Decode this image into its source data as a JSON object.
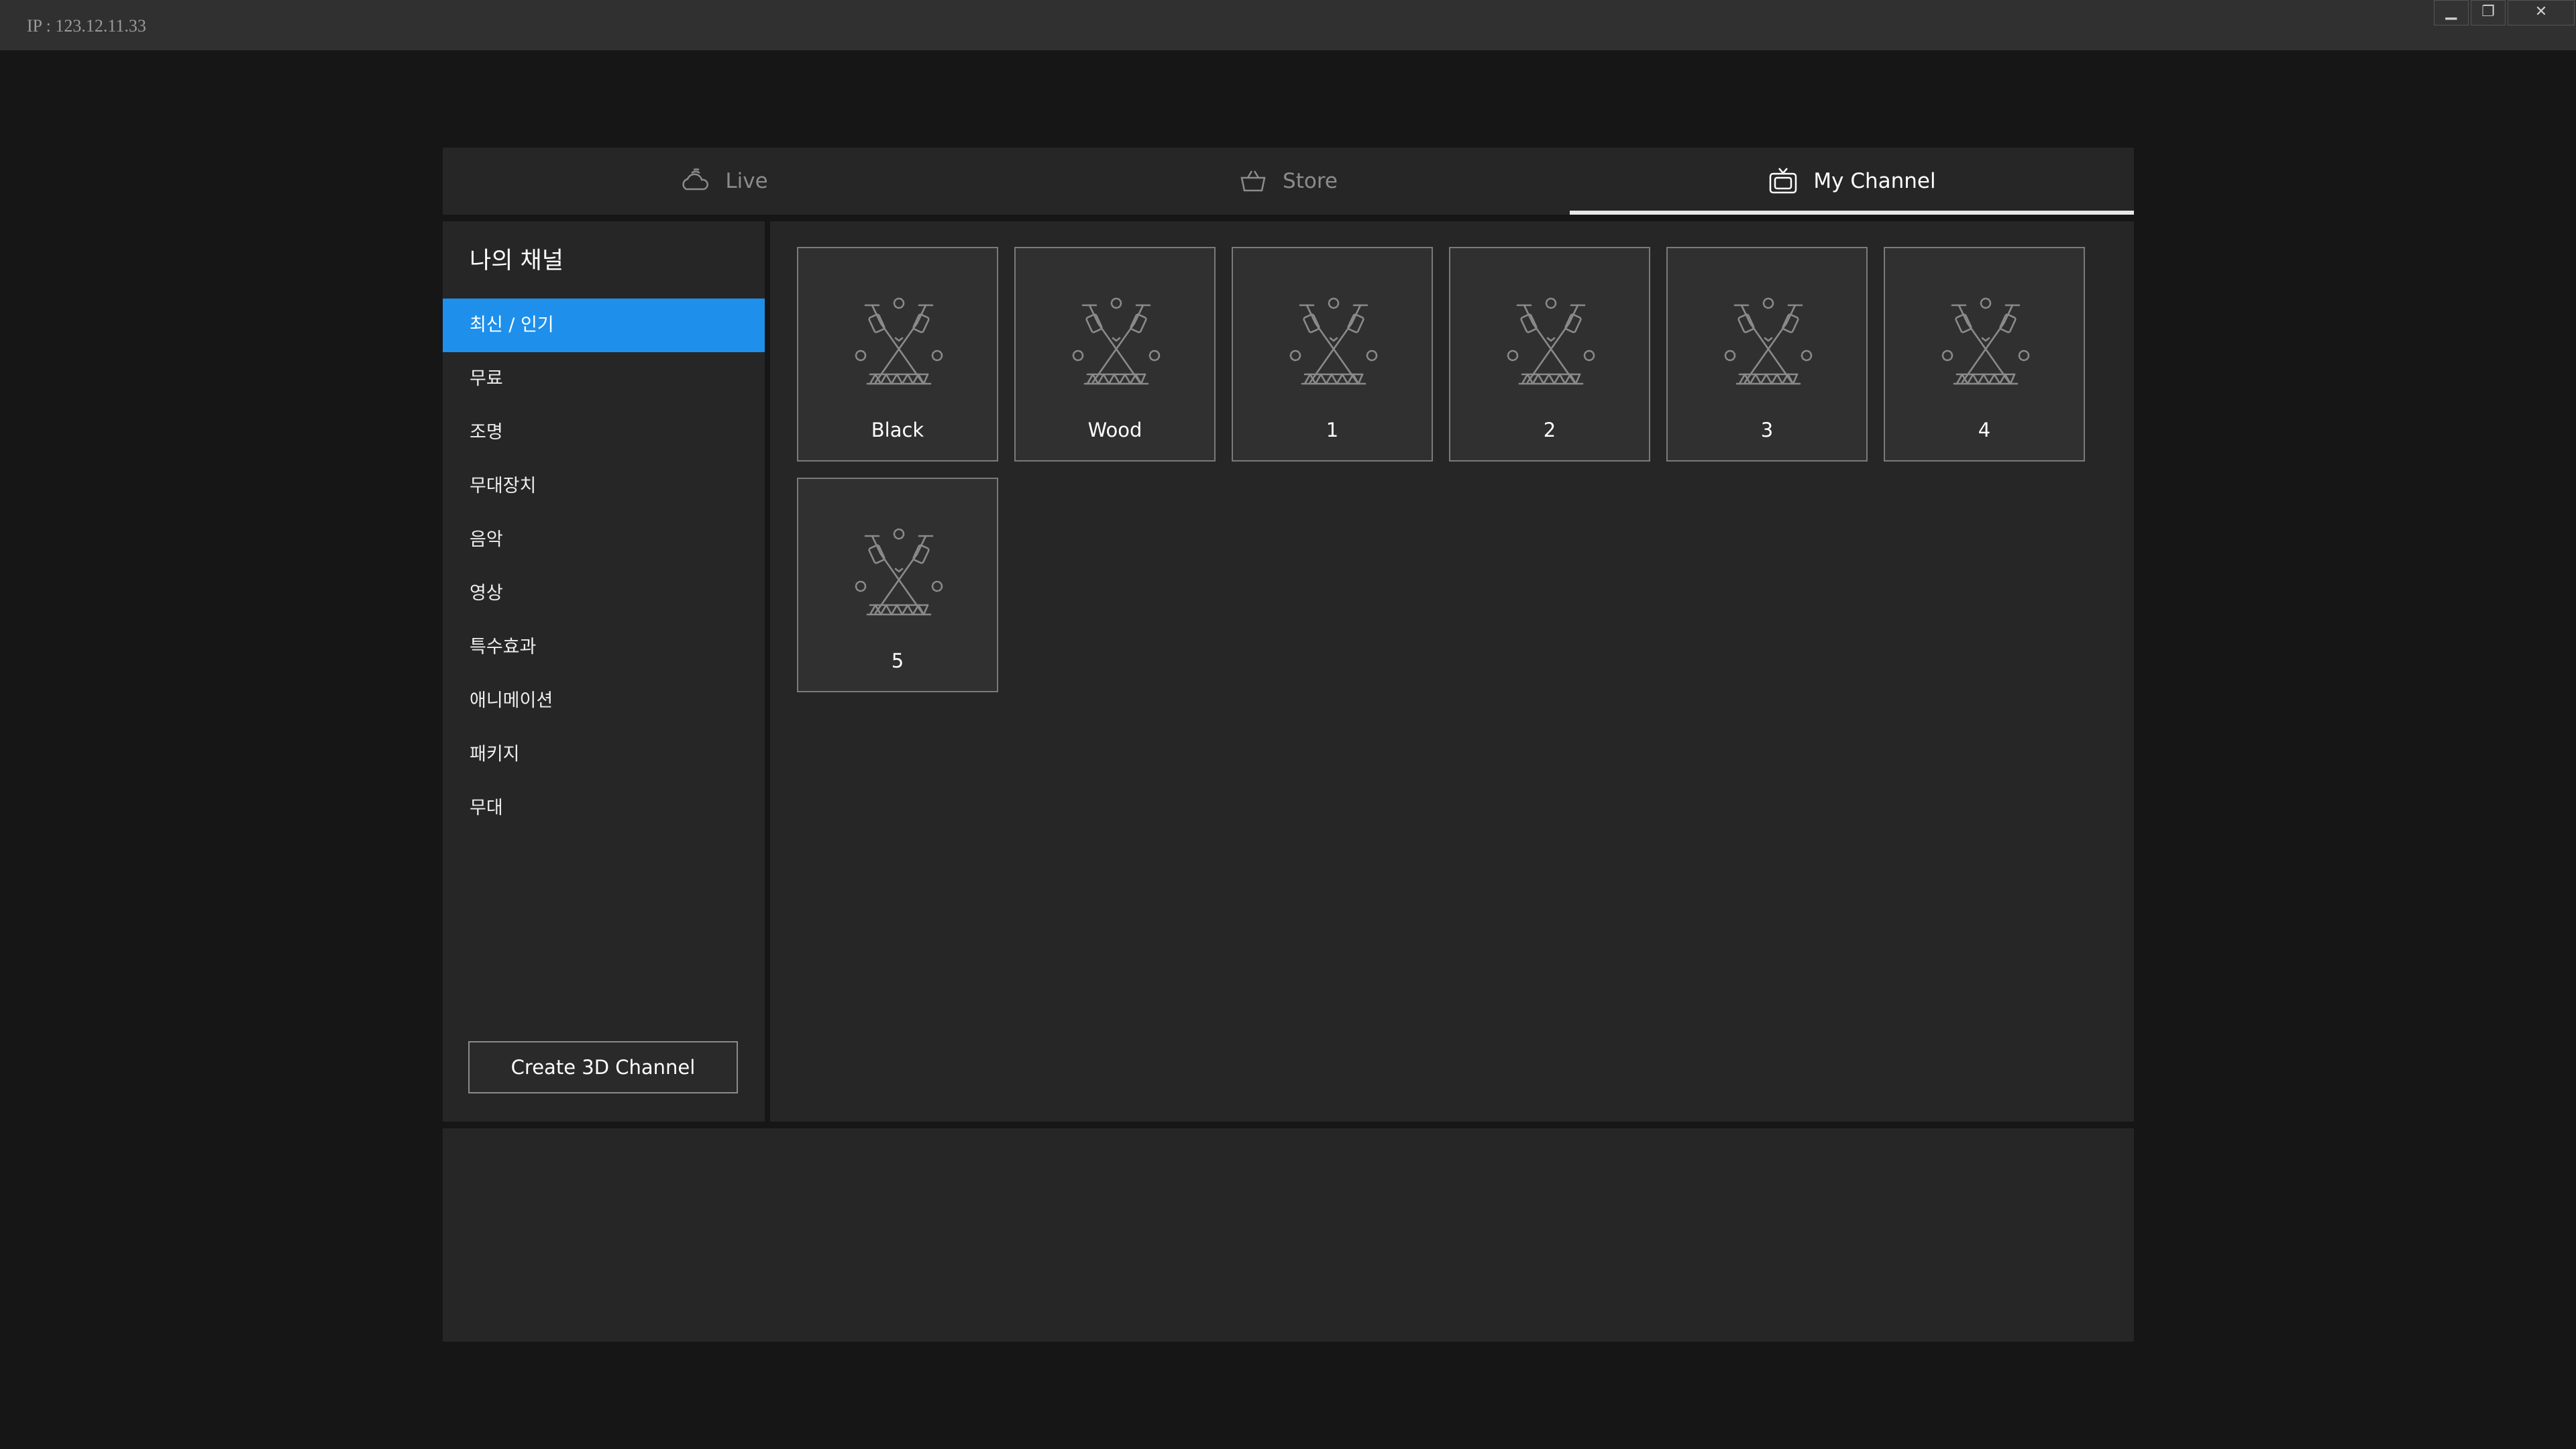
{
  "titlebar": {
    "ip_text": "IP : 123.12.11.33",
    "minimize_symbol": "▁",
    "restore_symbol": "❐",
    "close_symbol": "✕"
  },
  "tabs": [
    {
      "label": "Live",
      "icon": "cloud-icon",
      "active": false
    },
    {
      "label": "Store",
      "icon": "basket-icon",
      "active": false
    },
    {
      "label": "My Channel",
      "icon": "tv-icon",
      "active": true
    }
  ],
  "sidebar": {
    "title": "나의 채널",
    "items": [
      {
        "label": "최신 / 인기",
        "active": true
      },
      {
        "label": "무료",
        "active": false
      },
      {
        "label": "조명",
        "active": false
      },
      {
        "label": "무대장치",
        "active": false
      },
      {
        "label": "음악",
        "active": false
      },
      {
        "label": "영상",
        "active": false
      },
      {
        "label": "특수효과",
        "active": false
      },
      {
        "label": "애니메이션",
        "active": false
      },
      {
        "label": "패키지",
        "active": false
      },
      {
        "label": "무대",
        "active": false
      }
    ],
    "create_button": "Create 3D Channel"
  },
  "channels": [
    {
      "name": "Black",
      "icon": "stage-lights-icon"
    },
    {
      "name": "Wood",
      "icon": "stage-lights-icon"
    },
    {
      "name": "1",
      "icon": "stage-lights-icon"
    },
    {
      "name": "2",
      "icon": "stage-lights-icon"
    },
    {
      "name": "3",
      "icon": "stage-lights-icon"
    },
    {
      "name": "4",
      "icon": "stage-lights-icon"
    },
    {
      "name": "5",
      "icon": "stage-lights-icon"
    }
  ],
  "colors": {
    "accent": "#1e90eb",
    "background": "#161616",
    "panel": "#262626"
  }
}
